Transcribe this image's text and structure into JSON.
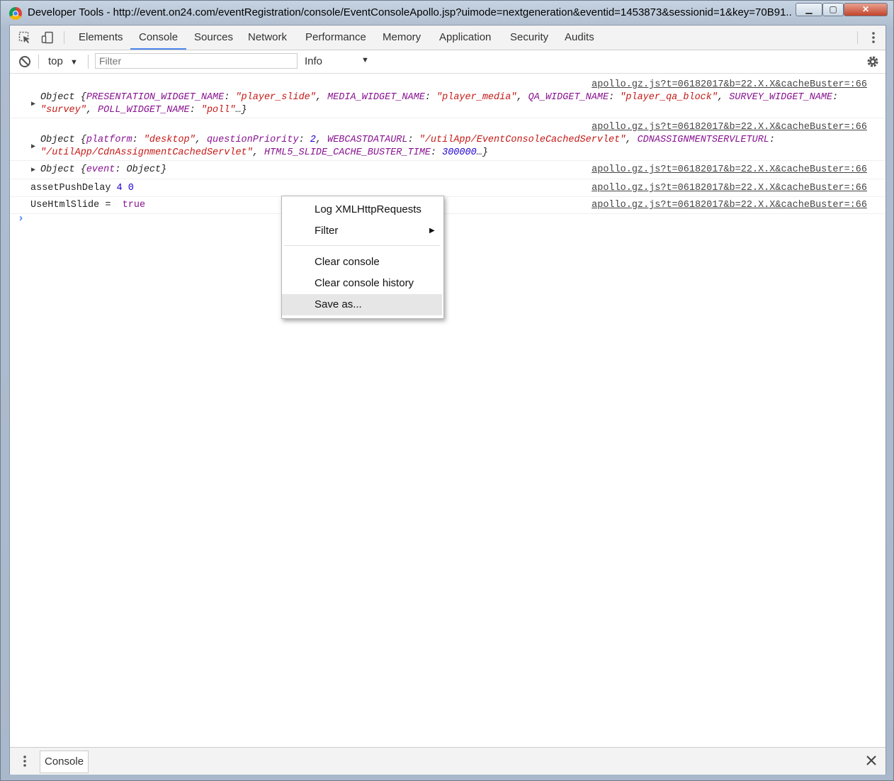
{
  "window": {
    "title": "Developer Tools - http://event.on24.com/eventRegistration/console/EventConsoleApollo.jsp?uimode=nextgeneration&eventid=1453873&sessionid=1&key=70B91...",
    "minimize_glyph": "▁",
    "maximize_glyph": "▢",
    "close_glyph": "✕"
  },
  "tabs": [
    "Elements",
    "Console",
    "Sources",
    "Network",
    "Performance",
    "Memory",
    "Application",
    "Security",
    "Audits"
  ],
  "active_tab": "Console",
  "toolbar": {
    "context": "top",
    "filter_placeholder": "Filter",
    "level": "Info"
  },
  "messages": {
    "source": "apollo.gz.js?t=06182017&b=22.X.X&cacheBuster=:66",
    "m1": {
      "obj": "Object {",
      "k1": "PRESENTATION_WIDGET_NAME",
      "v1": "\"player_slide\"",
      "k2": "MEDIA_WIDGET_NAME",
      "v2": "\"player_media\"",
      "k3": "QA_WIDGET_NAME",
      "v3": "\"player_qa_block\"",
      "k4": "SURVEY_WIDGET_NAME",
      "v4": "\"survey\"",
      "k5": "POLL_WIDGET_NAME",
      "v5": "\"poll\"",
      "tail": "…}"
    },
    "m2": {
      "obj": "Object {",
      "k1": "platform",
      "v1": "\"desktop\"",
      "k2": "questionPriority",
      "v2": "2",
      "k3": "WEBCASTDATAURL",
      "v3": "\"/utilApp/EventConsoleCachedServlet\"",
      "k4": "CDNASSIGNMENTSERVLETURL",
      "v4": "\"/utilApp/CdnAssignmentCachedServlet\"",
      "k5": "HTML5_SLIDE_CACHE_BUSTER_TIME",
      "v5": "300000",
      "tail": "…}"
    },
    "m3": {
      "obj": "Object {",
      "k1": "event",
      "v1": "Object",
      "tail": "}"
    },
    "m4": {
      "text": "assetPushDelay",
      "n1": "4",
      "n2": "0"
    },
    "m5": {
      "text": "UseHtmlSlide = ",
      "value": "true"
    }
  },
  "context_menu": {
    "items": [
      "Log XMLHttpRequests",
      "Filter",
      "Clear console",
      "Clear console history",
      "Save as..."
    ],
    "highlighted": "Save as..."
  },
  "drawer": {
    "tab": "Console"
  }
}
